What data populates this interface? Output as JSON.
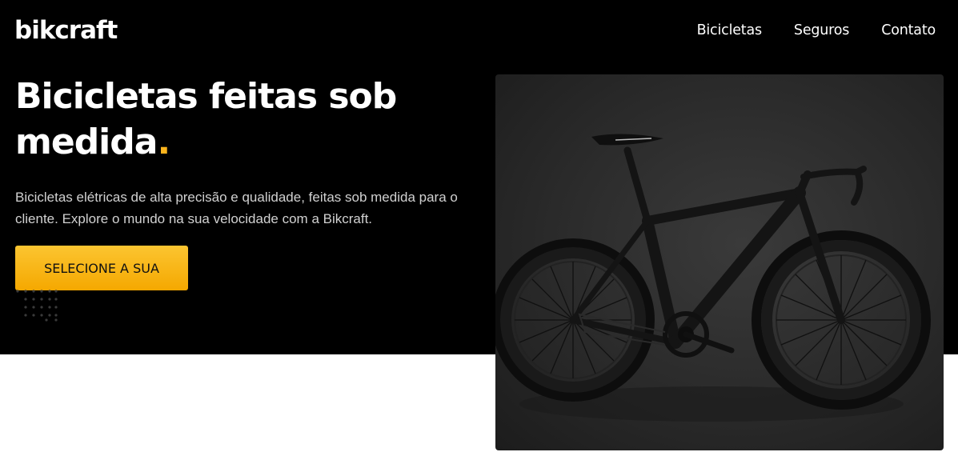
{
  "header": {
    "logo": "bikcraft",
    "nav": [
      "Bicicletas",
      "Seguros",
      "Contato"
    ]
  },
  "hero": {
    "title": "Bicicletas feitas sob medida",
    "title_punct": ".",
    "description": "Bicicletas elétricas de alta precisão e qualidade, feitas sob medida para o cliente. Explore o mundo na sua velocidade com a Bikcraft.",
    "cta_label": "SELECIONE A SUA"
  },
  "colors": {
    "background": "#000000",
    "accent": "#FBB41D",
    "text": "#FFFFFF"
  },
  "icons": {
    "decoration": "dot-grid-icon",
    "photo": "road-bicycle-image"
  }
}
